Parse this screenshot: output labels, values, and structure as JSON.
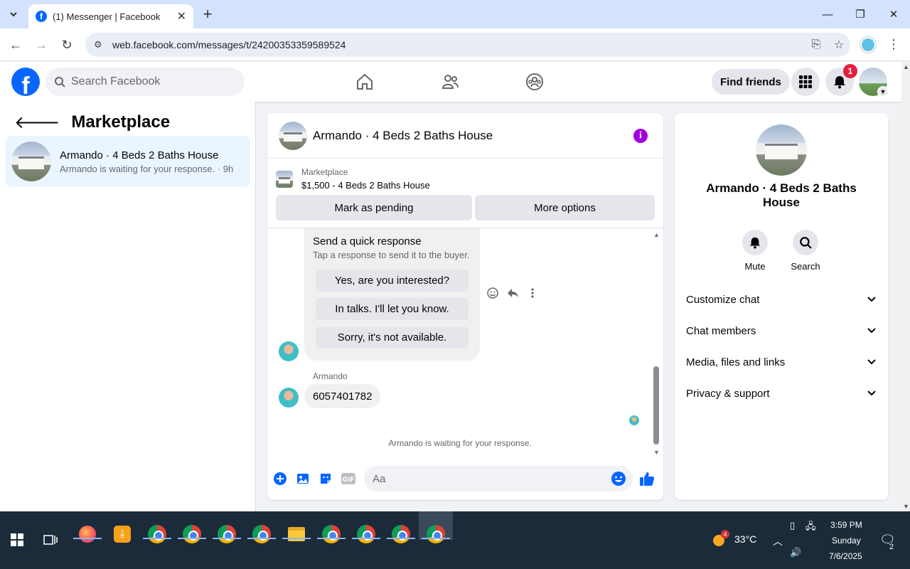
{
  "browser": {
    "tab_title": "(1) Messenger | Facebook",
    "url": "web.facebook.com/messages/t/24200353359589524"
  },
  "fb": {
    "search_placeholder": "Search Facebook",
    "find_friends": "Find friends",
    "notif_count": "1"
  },
  "left": {
    "title": "Marketplace",
    "conversation": {
      "title": "Armando · 4 Beds 2 Baths House",
      "subtitle": "Armando is waiting for your response. · 9h"
    }
  },
  "chat": {
    "header_name": "Armando · 4 Beds 2 Baths House",
    "marketplace_label": "Marketplace",
    "listing": "$1,500 - 4 Beds 2 Baths House",
    "mark_pending": "Mark as pending",
    "more_options": "More options",
    "quick_title": "Send a quick response",
    "quick_sub": "Tap a response to send it to the buyer.",
    "quick_replies": [
      "Yes, are you interested?",
      "In talks. I'll let you know.",
      "Sorry, it's not available."
    ],
    "sender_name": "Armando",
    "message": "6057401782",
    "waiting": "Armando is waiting for your response.",
    "input_placeholder": "Aa"
  },
  "right": {
    "name": "Armando · 4 Beds 2 Baths House",
    "mute": "Mute",
    "search": "Search",
    "sections": [
      "Customize chat",
      "Chat members",
      "Media, files and links",
      "Privacy & support"
    ]
  },
  "taskbar": {
    "temp": "33°C",
    "weather_badge": "4",
    "time": "3:59 PM",
    "day": "Sunday",
    "date": "7/6/2025",
    "notif_count": "2"
  }
}
